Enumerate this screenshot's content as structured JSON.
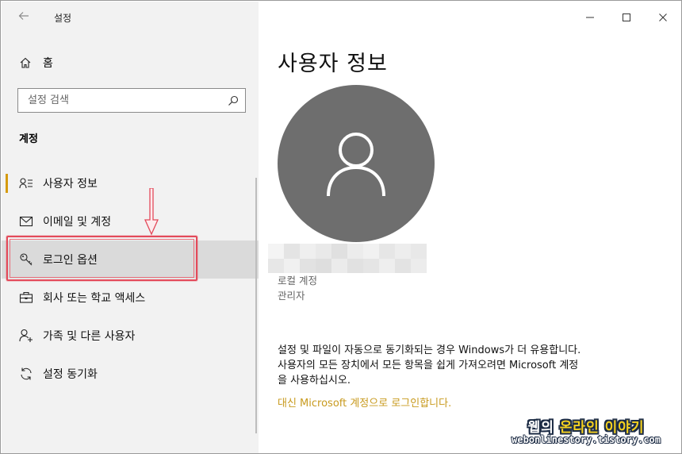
{
  "window": {
    "title": "설정",
    "controls": {
      "minimize": "—",
      "maximize": "☐",
      "close": "✕"
    }
  },
  "sidebar": {
    "home_label": "홈",
    "search_placeholder": "설정 검색",
    "section_title": "계정",
    "items": [
      {
        "label": "사용자 정보",
        "icon": "user-info-icon",
        "active": true
      },
      {
        "label": "이메일 및 계정",
        "icon": "mail-icon",
        "active": false
      },
      {
        "label": "로그인 옵션",
        "icon": "key-icon",
        "active": false,
        "highlighted": true
      },
      {
        "label": "회사 또는 학교 액세스",
        "icon": "briefcase-icon",
        "active": false
      },
      {
        "label": "가족 및 다른 사용자",
        "icon": "add-person-icon",
        "active": false
      },
      {
        "label": "설정 동기화",
        "icon": "sync-icon",
        "active": false
      }
    ]
  },
  "main": {
    "page_title": "사용자 정보",
    "account_type": "로컬 계정",
    "account_role": "관리자",
    "info_lines": [
      "설정 및 파일이 자동으로 동기화되는 경우 Windows가 더 유용합니다.",
      "사용자의 모든 장치에서 모든 항목을 쉽게 가져오려면 Microsoft 계정",
      "을 사용하십시오."
    ],
    "ms_signin_link": "대신 Microsoft 계정으로 로그인합니다."
  },
  "watermark": {
    "title_white": "웹의",
    "title_yellow_1": "온라인",
    "title_yellow_2": "이야기",
    "url": "webonlinestory.tistory.com"
  },
  "colors": {
    "accent": "#d59a0d",
    "link": "#c89a1e",
    "annotation": "#e34a5a",
    "avatar_bg": "#6e6e6e",
    "sidebar_bg": "#f2f2f2"
  }
}
